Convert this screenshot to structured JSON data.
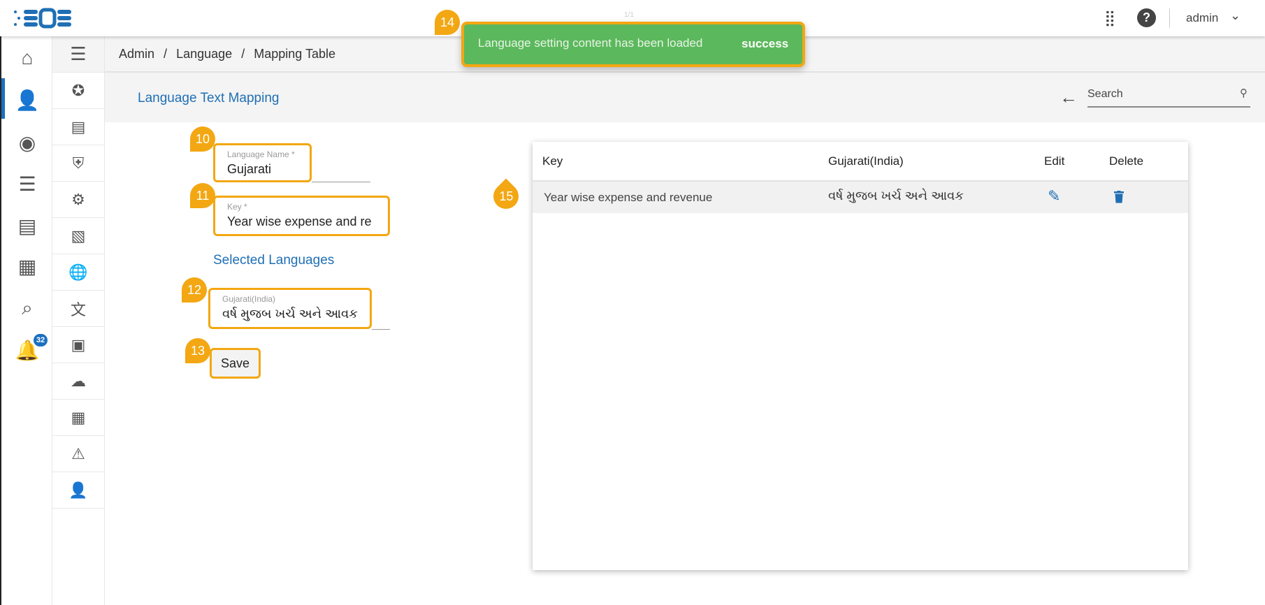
{
  "header": {
    "user": "admin",
    "icons": [
      "apps-grid-icon",
      "help-icon",
      "chevron-down-icon"
    ]
  },
  "toast": {
    "message": "Language setting content has been loaded",
    "status": "success",
    "counter": "1/1",
    "color": "#5cb85c"
  },
  "breadcrumb": [
    "Admin",
    "/",
    "Language",
    "/",
    "Mapping Table"
  ],
  "page": {
    "title": "Language Text Mapping",
    "search_placeholder": "Search"
  },
  "form": {
    "language_name_label": "Language Name *",
    "language_name_value": "Gujarati",
    "key_label": "Key *",
    "key_value": "Year wise expense and re",
    "selected_languages_heading": "Selected Languages",
    "gujarati_label": "Gujarati(India)",
    "gujarati_value": "વર્ષ મુજબ ખર્ચ અને આવક",
    "save_label": "Save"
  },
  "table": {
    "headers": [
      "Key",
      "Gujarati(India)",
      "Edit",
      "Delete"
    ],
    "rows": [
      {
        "key": "Year wise expense and revenue",
        "gujarati": "વર્ષ મુજબ ખર્ચ અને આવક"
      }
    ]
  },
  "notifications": {
    "count": "32"
  },
  "annotations": [
    "10",
    "11",
    "12",
    "13",
    "14",
    "15"
  ],
  "colors": {
    "accent": "#1f6fb5",
    "annotation": "#f3a712"
  }
}
